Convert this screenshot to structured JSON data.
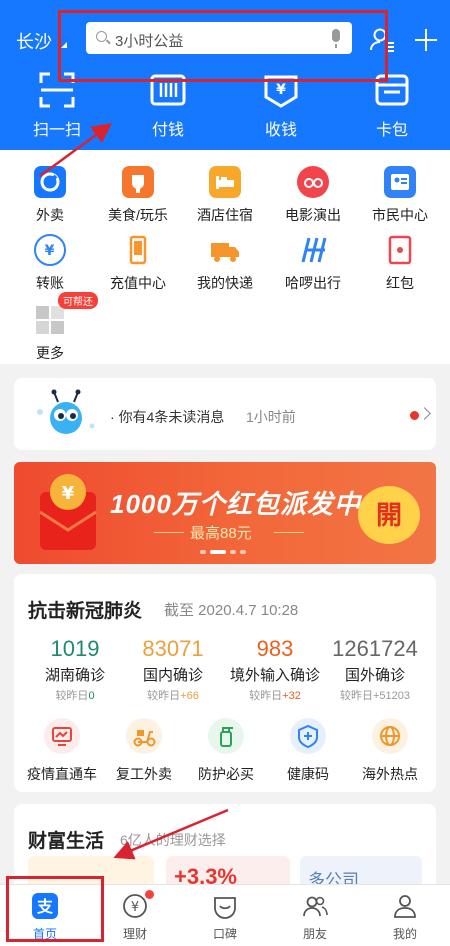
{
  "header": {
    "city": "长沙",
    "search_placeholder": "3小时公益",
    "actions": [
      {
        "label": "扫一扫"
      },
      {
        "label": "付钱"
      },
      {
        "label": "收钱"
      },
      {
        "label": "卡包"
      }
    ],
    "accent_color": "#1677ff"
  },
  "services": [
    {
      "label": "外卖",
      "icon": "takeout-icon",
      "color": "#1677ff"
    },
    {
      "label": "美食/玩乐",
      "icon": "food-icon",
      "color": "#f5762c"
    },
    {
      "label": "酒店住宿",
      "icon": "hotel-icon",
      "color": "#f7a82b"
    },
    {
      "label": "电影演出",
      "icon": "movie-icon",
      "color": "#f0454c"
    },
    {
      "label": "市民中心",
      "icon": "citizen-icon",
      "color": "#2f83f5"
    },
    {
      "label": "转账",
      "icon": "transfer-icon",
      "color": "#2f83f5"
    },
    {
      "label": "充值中心",
      "icon": "phone-icon",
      "color": "#f5952b"
    },
    {
      "label": "我的快递",
      "icon": "truck-icon",
      "color": "#f5952b"
    },
    {
      "label": "哈啰出行",
      "icon": "hellobike-icon",
      "color": "#2f83f5"
    },
    {
      "label": "红包",
      "icon": "red-packet-icon",
      "color": "#f0454c"
    },
    {
      "label": "更多",
      "icon": "more-grid-icon",
      "color": "#c7c7c7",
      "badge": "可帮还"
    }
  ],
  "message": {
    "text": "你有4条未读消息",
    "time": "1小时前"
  },
  "banner": {
    "title": "1000万个红包派发中",
    "subtitle": "最高88元",
    "button": "開"
  },
  "covid": {
    "title": "抗击新冠肺炎",
    "date": "截至 2020.4.7 10:28",
    "stats": [
      {
        "num": "1019",
        "name": "湖南确诊",
        "delta_label": "较昨日",
        "delta": "0",
        "num_color": "#1f8a6e",
        "delta_color": "#1f8a6e"
      },
      {
        "num": "83071",
        "name": "国内确诊",
        "delta_label": "较昨日",
        "delta": "+66",
        "num_color": "#e9a13b",
        "delta_color": "#e9a13b"
      },
      {
        "num": "983",
        "name": "境外输入确诊",
        "delta_label": "较昨日",
        "delta": "+32",
        "num_color": "#e8621e",
        "delta_color": "#e8621e"
      },
      {
        "num": "1261724",
        "name": "国外确诊",
        "delta_label": "较昨日",
        "delta": "+51203",
        "num_color": "#666666",
        "delta_color": "#999999"
      }
    ],
    "links": [
      {
        "label": "疫情直通车",
        "icon": "monitor-icon"
      },
      {
        "label": "复工外卖",
        "icon": "scooter-icon"
      },
      {
        "label": "防护必买",
        "icon": "spray-icon"
      },
      {
        "label": "健康码",
        "icon": "health-shield-icon"
      },
      {
        "label": "海外热点",
        "icon": "globe-icon"
      }
    ]
  },
  "wealth": {
    "title": "财富生活",
    "subtitle": "6亿人的理财选择",
    "rate": "+3.3%",
    "company": "多公司"
  },
  "tabs": [
    {
      "label": "首页",
      "icon": "alipay-icon",
      "active": true
    },
    {
      "label": "理财",
      "icon": "wealth-icon"
    },
    {
      "label": "口碑",
      "icon": "koubei-icon"
    },
    {
      "label": "朋友",
      "icon": "friends-icon"
    },
    {
      "label": "我的",
      "icon": "profile-icon"
    }
  ]
}
